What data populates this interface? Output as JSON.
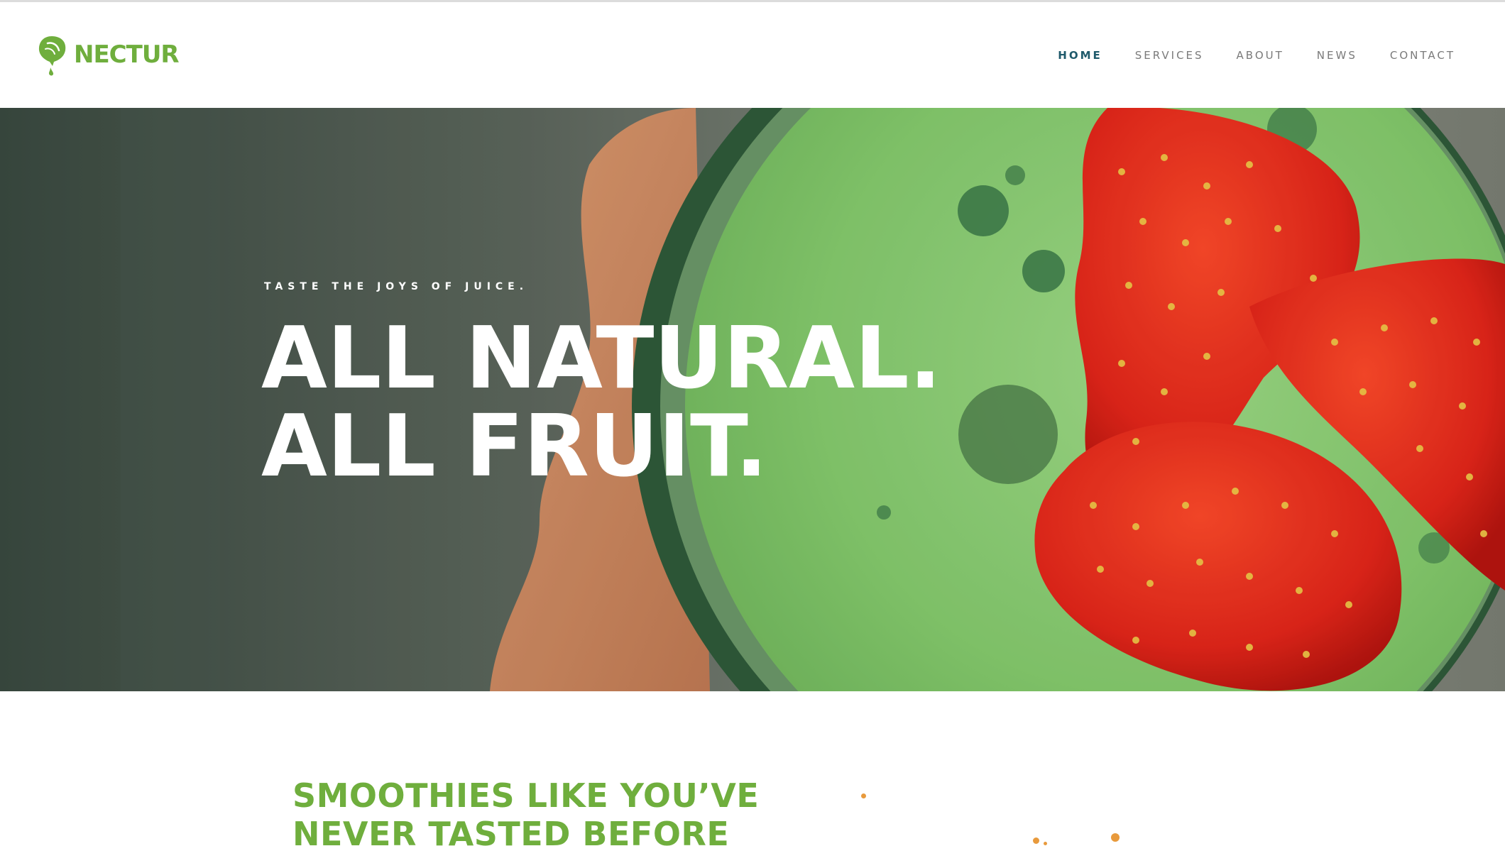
{
  "brand": {
    "name": "NECTUR",
    "logo_icon": "lemon-drop-icon",
    "color": "#6fae3d"
  },
  "nav": {
    "items": [
      {
        "label": "HOME",
        "active": true
      },
      {
        "label": "SERVICES",
        "active": false
      },
      {
        "label": "ABOUT",
        "active": false
      },
      {
        "label": "NEWS",
        "active": false
      },
      {
        "label": "CONTACT",
        "active": false
      }
    ],
    "active_color": "#1f5a6b"
  },
  "hero": {
    "eyebrow": "TASTE THE JOYS OF JUICE.",
    "headline_line1": "ALL NATURAL.",
    "headline_line2": "ALL FRUIT."
  },
  "section": {
    "title_line1": "SMOOTHIES LIKE YOU’VE",
    "title_line2": "NEVER TASTED BEFORE",
    "accent_color": "#6fae3d"
  }
}
